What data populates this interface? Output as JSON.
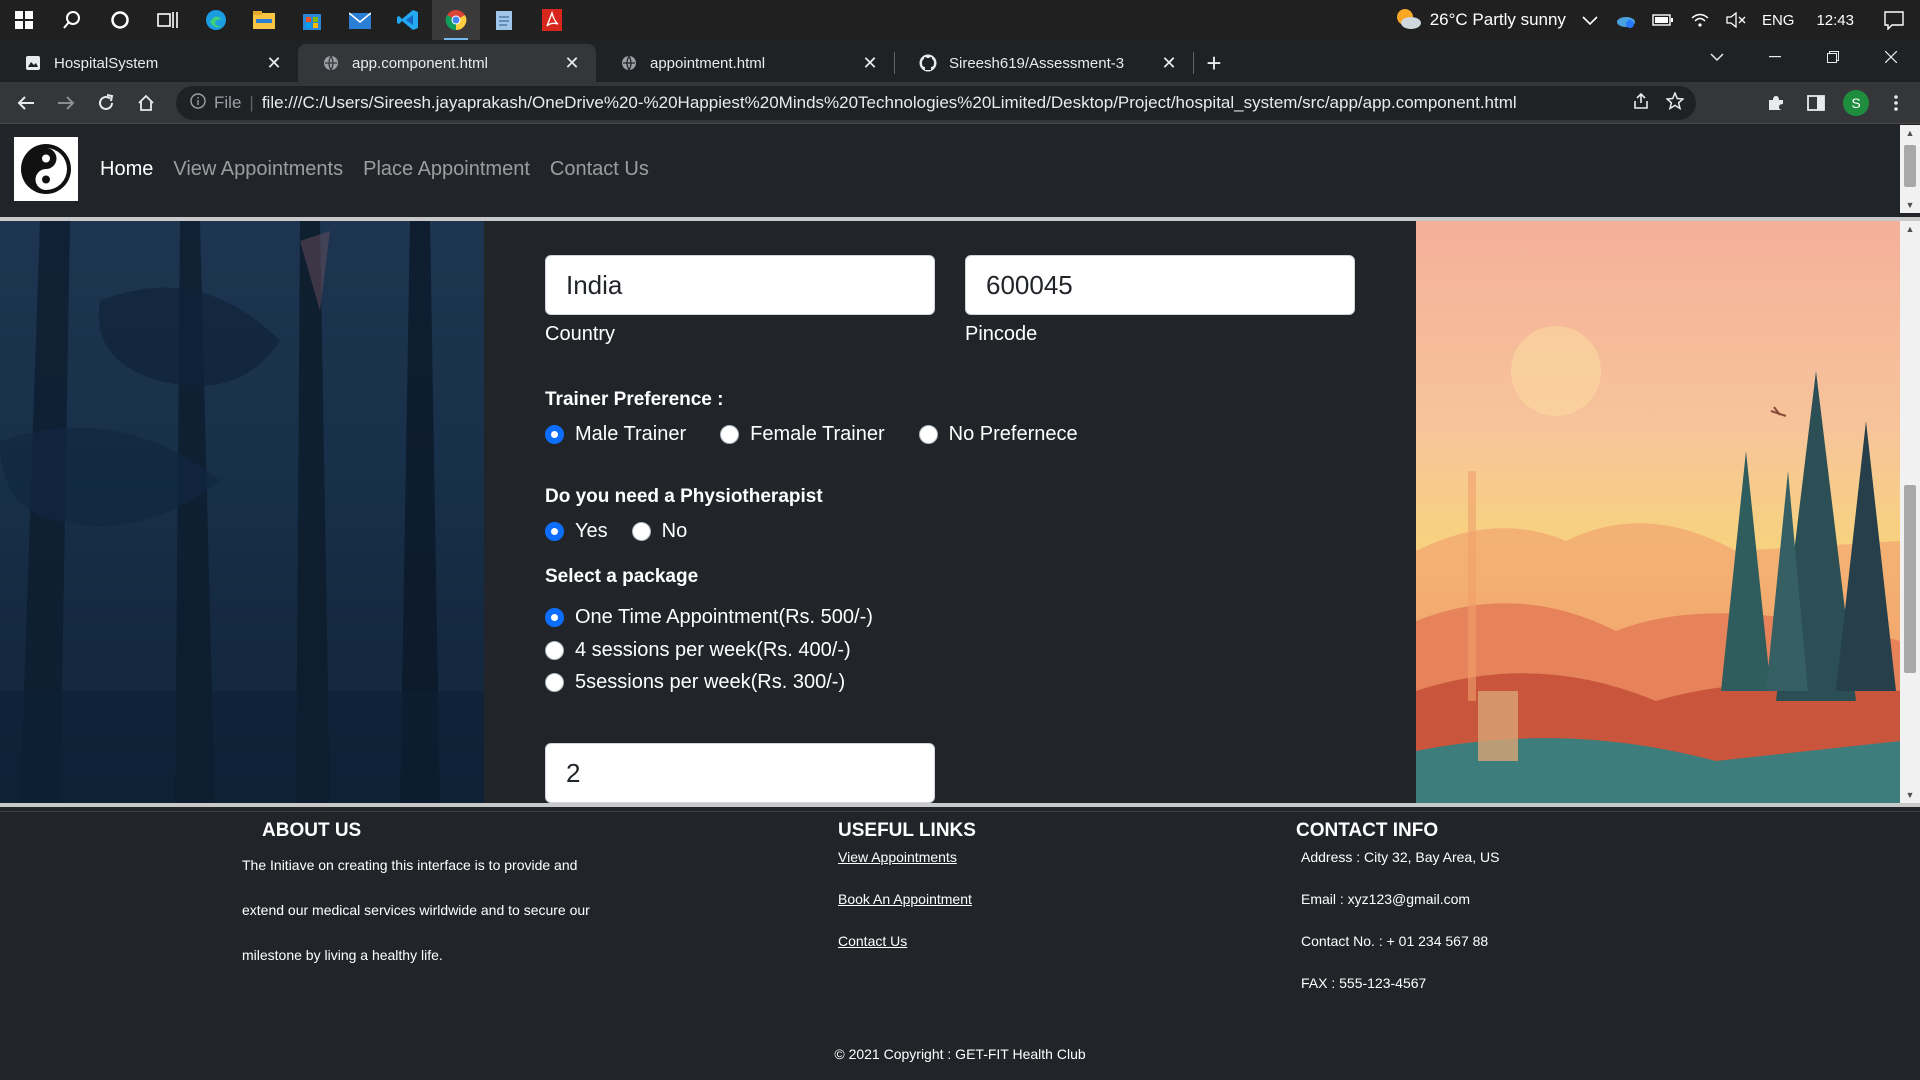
{
  "taskbar": {
    "icons": [
      "windows-start-icon",
      "search-icon",
      "cortana-icon",
      "task-view-icon",
      "edge-icon",
      "file-explorer-icon",
      "store-icon",
      "mail-icon",
      "vscode-icon",
      "chrome-icon",
      "notepad-icon",
      "acrobat-icon"
    ],
    "weather": "26°C  Partly sunny",
    "language": "ENG",
    "time": "12:43"
  },
  "browser": {
    "tabs": [
      {
        "title": "HospitalSystem",
        "icon": "page-icon",
        "active": false
      },
      {
        "title": "app.component.html",
        "icon": "globe-icon",
        "active": true
      },
      {
        "title": "appointment.html",
        "icon": "globe-icon",
        "active": false
      },
      {
        "title": "Sireesh619/Assessment-3",
        "icon": "github-icon",
        "active": false
      }
    ],
    "url_scheme_label": "File",
    "url": "file:///C:/Users/Sireesh.jayaprakash/OneDrive%20-%20Happiest%20Minds%20Technologies%20Limited/Desktop/Project/hospital_system/src/app/app.component.html",
    "profile_initial": "S"
  },
  "nav": {
    "links": [
      "Home",
      "View Appointments",
      "Place Appointment",
      "Contact Us"
    ]
  },
  "form": {
    "country_value": "India",
    "country_label": "Country",
    "pincode_value": "600045",
    "pincode_label": "Pincode",
    "trainer_heading": "Trainer Preference :",
    "trainer_options": [
      "Male Trainer",
      "Female Trainer",
      "No Prefernece"
    ],
    "trainer_selected": 0,
    "physio_heading": "Do you need a Physiotherapist",
    "physio_options": [
      "Yes",
      "No"
    ],
    "physio_selected": 0,
    "package_heading": "Select a package",
    "package_options": [
      "One Time Appointment(Rs. 500/-)",
      "4 sessions per week(Rs. 400/-)",
      "5sessions per week(Rs. 300/-)"
    ],
    "package_selected": 0,
    "quantity_value": "2"
  },
  "footer": {
    "about_heading": "ABOUT US",
    "about_lines": [
      "The Initiave on creating this interface is to provide and",
      "extend our medical services wirldwide and to secure our",
      "milestone by living a healthy life."
    ],
    "links_heading": "USEFUL LINKS",
    "links": [
      "View Appointments",
      "Book An Appointment",
      "Contact Us"
    ],
    "contact_heading": "CONTACT INFO",
    "contact_lines": [
      "Address : City 32, Bay Area, US",
      "Email : xyz123@gmail.com",
      "Contact No. : + 01 234 567 88",
      "FAX : 555-123-4567"
    ],
    "copyright": "© 2021 Copyright : GET-FIT Health Club"
  },
  "colors": {
    "accent": "#0d6efd",
    "page_bg": "#212529"
  }
}
